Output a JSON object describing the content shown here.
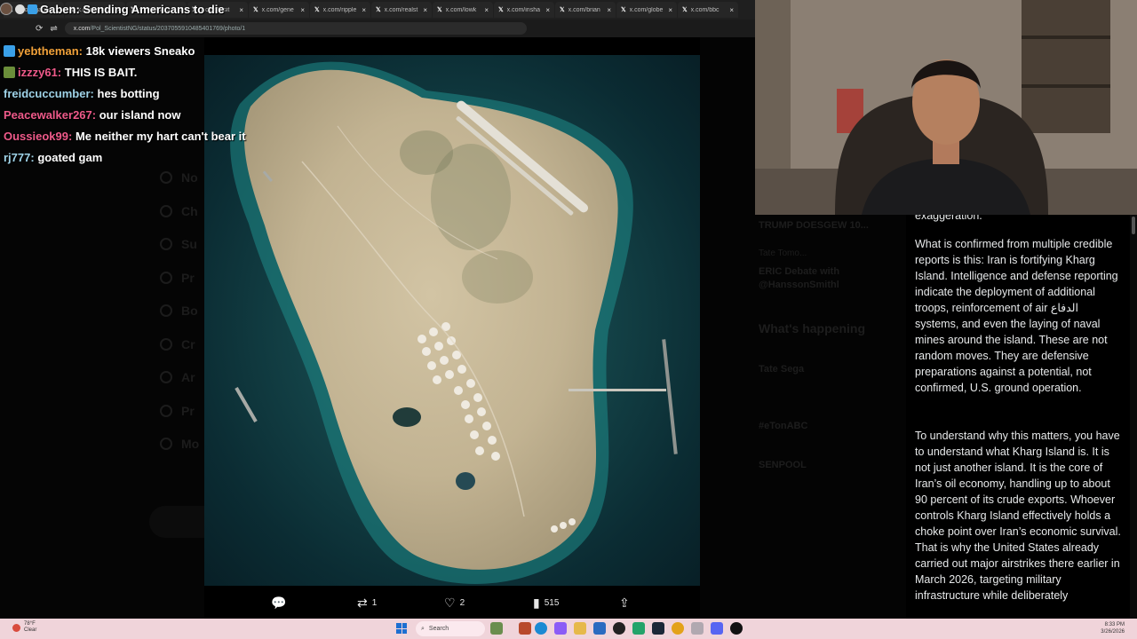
{
  "stream": {
    "title": "Gaben: Sending Americans to die"
  },
  "browser": {
    "tabs": [
      {
        "label": "x.com/gaben"
      },
      {
        "label": "x.com/story"
      },
      {
        "label": "x.com/baro"
      },
      {
        "label": "x.com/visit"
      },
      {
        "label": "x.com/gene"
      },
      {
        "label": "x.com/ripple"
      },
      {
        "label": "x.com/realst"
      },
      {
        "label": "x.com/lowk"
      },
      {
        "label": "x.com/insha"
      },
      {
        "label": "x.com/brian"
      },
      {
        "label": "x.com/globe"
      },
      {
        "label": "x.com/bbc"
      }
    ],
    "url_domain": "x.com",
    "url_path": "/Pol_ScientistNG/status/2037055910485401769/photo/1"
  },
  "chat": {
    "messages": [
      {
        "user": "yebtheman:",
        "text": "18k viewers Sneako",
        "color": "#f2a23a"
      },
      {
        "user": "izzzy61:",
        "text": "THIS IS BAIT.",
        "color": "#ef5a8a"
      },
      {
        "user": "freidcuccumber:",
        "text": "hes botting",
        "color": "#9fd3e8"
      },
      {
        "user": "Peacewalker267:",
        "text": "our island now",
        "color": "#ef5a8a"
      },
      {
        "user": "Oussieok99:",
        "text": "Me neither my hart can't bear it",
        "color": "#ef5a8a"
      },
      {
        "user": "rj777:",
        "text": "goated gam",
        "color": "#9fd3e8"
      }
    ]
  },
  "twitter_sidebar": {
    "items": [
      {
        "label": "No",
        "icon": "bell-icon"
      },
      {
        "label": "Ch",
        "icon": "mail-icon"
      },
      {
        "label": "Su",
        "icon": "grok-icon"
      },
      {
        "label": "Pr",
        "icon": "premium-icon"
      },
      {
        "label": "Bo",
        "icon": "bookmark-icon"
      },
      {
        "label": "Cr",
        "icon": "rocket-icon"
      },
      {
        "label": "Ar",
        "icon": "article-icon"
      },
      {
        "label": "Pr",
        "icon": "profile-icon"
      },
      {
        "label": "Mo",
        "icon": "more-icon"
      }
    ]
  },
  "twitter_right": {
    "trend_title": "TRUMP DOESGEW 10...",
    "trend_line1": "Tate Tomo...",
    "trend_line2": "ERIC Debate with",
    "trend_line3": "@HanssonSmithl",
    "whats_happening": "What's happening",
    "trends": [
      "Tate Sega",
      "#eTonABC",
      "SENPOOL"
    ]
  },
  "tweet_actions": {
    "reply": "",
    "retweet": "1",
    "like": "2",
    "views": "515"
  },
  "article": {
    "cut_line": "exaggeration.",
    "paragraph1": "What is confirmed from multiple credible reports is this: Iran is fortifying Kharg Island. Intelligence and defense reporting indicate the deployment of additional troops, reinforcement of air الدفاع systems, and even the laying of naval mines around the island.  These are not random moves. They are defensive preparations against a potential, not confirmed, U.S. ground operation.",
    "paragraph2": "To understand why this matters, you have to understand what Kharg Island is. It is not just another island. It is the core of Iran’s oil economy, handling up to about 90 percent of its crude exports.  Whoever controls Kharg Island effectively holds a choke point over Iran’s economic survival. That is why the United States already carried out major airstrikes there earlier in March 2026, targeting military infrastructure while deliberately"
  },
  "taskbar": {
    "weather_temp": "78°F",
    "weather_desc": "Clear",
    "search_placeholder": "Search",
    "time": "8:33 PM",
    "date": "3/26/2026"
  },
  "colors": {
    "taskbar": "#f0d4da",
    "tweet_panel": "#000000",
    "sea": "#134146",
    "land": "#c7b99a"
  }
}
